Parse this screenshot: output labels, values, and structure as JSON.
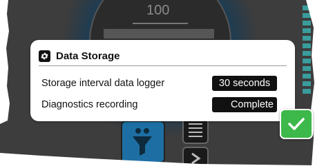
{
  "gauge": {
    "top_value": "100"
  },
  "dialog": {
    "title": "Data Storage",
    "rows": [
      {
        "label": "Storage interval data logger",
        "value": "30 seconds"
      },
      {
        "label": "Diagnostics recording",
        "value": "Complete"
      }
    ]
  },
  "colors": {
    "confirm": "#3db84a",
    "value_box": "#111111",
    "dialog_bg": "#ffffff"
  },
  "icons": {
    "dialog_icon": "gear-icon",
    "confirm_icon": "check-icon",
    "filter_icon": "funnel-icon",
    "list_icon": "list-icon",
    "next_icon": "chevron-right-icon"
  }
}
